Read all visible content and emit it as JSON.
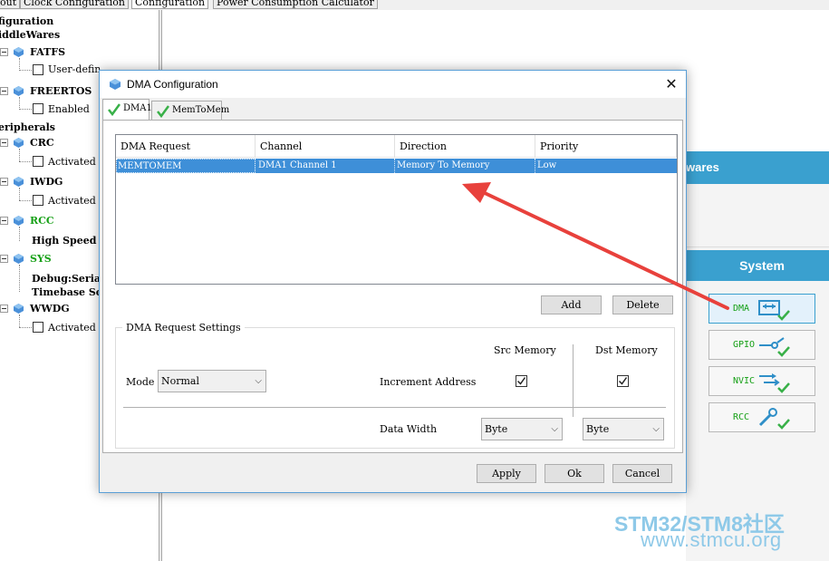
{
  "top_tabs": [
    {
      "label": "out",
      "active": false
    },
    {
      "label": "Clock Configuration",
      "active": false
    },
    {
      "label": "Configuration",
      "active": true
    },
    {
      "label": "Power Consumption Calculator",
      "active": false
    }
  ],
  "tree": {
    "configuration": "figuration",
    "middlewares": "iddleWares",
    "fatfs": "FATFS",
    "fatfs_child": "User-defin",
    "freertos": "FREERTOS",
    "freertos_child": "Enabled",
    "peripherals": "eripherals",
    "crc": "CRC",
    "crc_child": "Activated",
    "iwdg": "IWDG",
    "iwdg_child": "Activated",
    "rcc": "RCC",
    "rcc_child": "High Speed",
    "sys": "SYS",
    "sys_child1": "Debug:Serial",
    "sys_child2": "Timebase So",
    "wwdg": "WWDG",
    "wwdg_child": "Activated"
  },
  "right_panel": {
    "middlewares_label": "wares",
    "system_label": "System",
    "buttons": [
      {
        "label": "DMA",
        "icon": "dma-icon",
        "selected": true
      },
      {
        "label": "GPIO",
        "icon": "gpio-icon",
        "selected": false
      },
      {
        "label": "NVIC",
        "icon": "nvic-icon",
        "selected": false
      },
      {
        "label": "RCC",
        "icon": "rcc-icon",
        "selected": false
      }
    ]
  },
  "watermark": {
    "line1": "STM32/STM8社区",
    "line2": "www.stmcu.org"
  },
  "dialog": {
    "title": "DMA Configuration",
    "close_glyph": "✕",
    "tabs": [
      {
        "label": "DMA1",
        "active": true
      },
      {
        "label": "MemToMem",
        "active": false
      }
    ],
    "table": {
      "columns": [
        "DMA Request",
        "Channel",
        "Direction",
        "Priority"
      ],
      "rows": [
        {
          "request": "MEMTOMEM",
          "channel": "DMA1 Channel 1",
          "direction": "Memory To Memory",
          "priority": "Low",
          "selected": true
        }
      ]
    },
    "add_label": "Add",
    "delete_label": "Delete",
    "settings": {
      "group_title": "DMA Request Settings",
      "mode_label": "Mode",
      "mode_value": "Normal",
      "src_memory_label": "Src Memory",
      "dst_memory_label": "Dst Memory",
      "increment_label": "Increment Address",
      "src_increment": true,
      "dst_increment": true,
      "data_width_label": "Data Width",
      "src_width": "Byte",
      "dst_width": "Byte"
    },
    "apply_label": "Apply",
    "ok_label": "Ok",
    "cancel_label": "Cancel"
  },
  "colors": {
    "accent_blue": "#3aa0cf",
    "selection_blue": "#3e8fd8",
    "tree_green": "#16a016",
    "annotation_red": "#e8413c"
  }
}
